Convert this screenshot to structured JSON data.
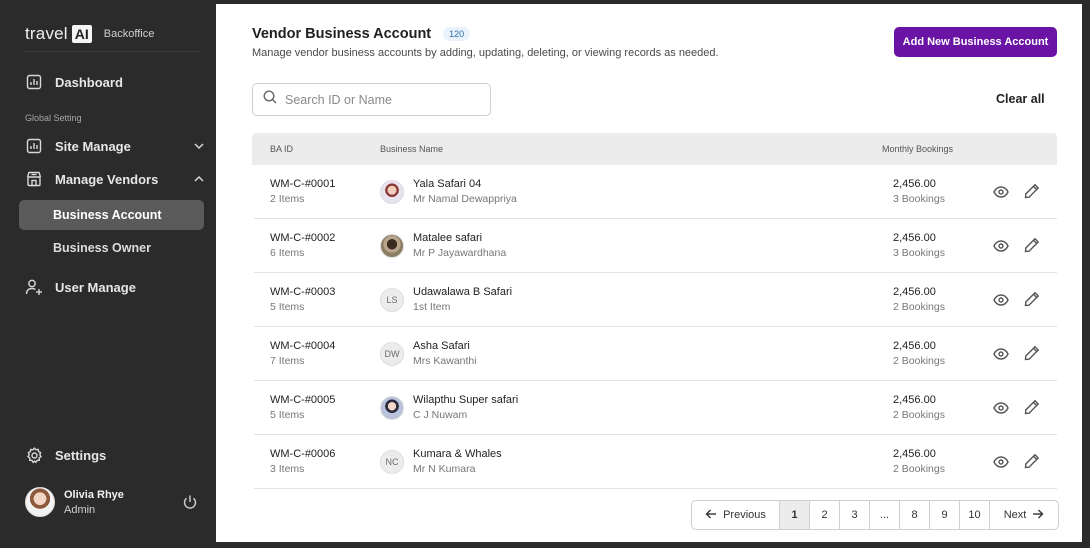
{
  "brand": {
    "name": "travel",
    "ai": "AI",
    "sub": "Backoffice"
  },
  "sidebar": {
    "dashboard": "Dashboard",
    "section_label": "Global Setting",
    "site_manage": "Site Manage",
    "manage_vendors": "Manage Vendors",
    "business_account": "Business Account",
    "business_owner": "Business Owner",
    "user_manage": "User Manage",
    "settings": "Settings"
  },
  "user": {
    "name": "Olivia Rhye",
    "role": "Admin"
  },
  "page": {
    "title": "Vendor Business Account",
    "count": "120",
    "subtitle": "Manage vendor business accounts by adding, updating, deleting, or viewing records as needed.",
    "add_button": "Add New Business Account",
    "search_placeholder": "Search ID or Name",
    "clear_all": "Clear all"
  },
  "table": {
    "columns": {
      "id": "BA ID",
      "name": "Business Name",
      "bookings": "Monthly Bookings"
    },
    "rows": [
      {
        "id": "WM-C-#0001",
        "items": "2 Items",
        "avatar": "",
        "name": "Yala Safari 04",
        "owner": "Mr Namal Dewappriya",
        "amount": "2,456.00",
        "bookings": "3 Bookings"
      },
      {
        "id": "WM-C-#0002",
        "items": "6 Items",
        "avatar": "",
        "name": "Matalee safari",
        "owner": "Mr P Jayawardhana",
        "amount": "2,456.00",
        "bookings": "3 Bookings"
      },
      {
        "id": "WM-C-#0003",
        "items": "5 Items",
        "avatar": "LS",
        "name": "Udawalawa B Safari",
        "owner": "1st Item",
        "amount": "2,456.00",
        "bookings": "2 Bookings"
      },
      {
        "id": "WM-C-#0004",
        "items": "7 Items",
        "avatar": "DW",
        "name": "Asha Safari",
        "owner": "Mrs Kawanthi",
        "amount": "2,456.00",
        "bookings": "2 Bookings"
      },
      {
        "id": "WM-C-#0005",
        "items": "5 Items",
        "avatar": "",
        "name": "Wilapthu Super safari",
        "owner": "C J Nuwam",
        "amount": "2,456.00",
        "bookings": "2 Bookings"
      },
      {
        "id": "WM-C-#0006",
        "items": "3 Items",
        "avatar": "NC",
        "name": "Kumara & Whales",
        "owner": "Mr N Kumara",
        "amount": "2,456.00",
        "bookings": "2 Bookings"
      }
    ]
  },
  "pagination": {
    "previous": "Previous",
    "next": "Next",
    "pages": [
      "1",
      "2",
      "3",
      "...",
      "8",
      "9",
      "10"
    ],
    "current": "1"
  },
  "colors": {
    "accent": "#6a14a6",
    "sidebar": "#2b2b2b",
    "active_item": "#5a5a5a"
  }
}
